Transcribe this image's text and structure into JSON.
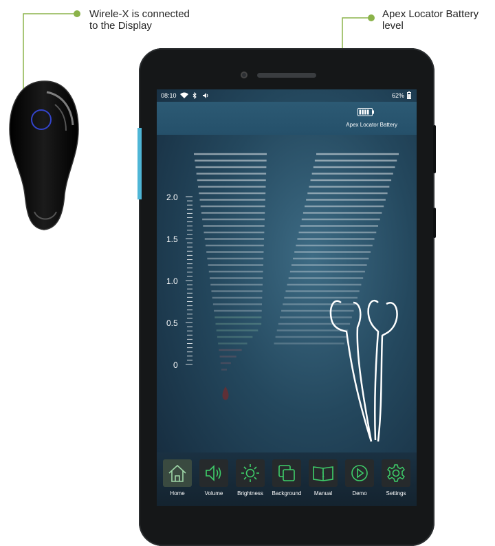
{
  "callouts": {
    "wireless": {
      "line1": "Wirele-X is connected",
      "line2": "to the Display"
    },
    "battery": {
      "line1": "Apex Locator Battery",
      "line2": "level"
    }
  },
  "status_bar": {
    "time": "08:10",
    "battery_percent": "62%",
    "icons": [
      "wifi-icon",
      "bluetooth-icon",
      "volume-icon",
      "battery-icon"
    ]
  },
  "battery_indicator": {
    "label": "Apex Locator Battery",
    "level_fraction": 0.8
  },
  "scale": {
    "labels": [
      "2.0",
      "1.5",
      "1.0",
      "0.5",
      "0"
    ]
  },
  "toolbar": {
    "items": [
      {
        "label": "Home",
        "icon": "home-icon"
      },
      {
        "label": "Volume",
        "icon": "volume-icon"
      },
      {
        "label": "Brightness",
        "icon": "sun-icon"
      },
      {
        "label": "Background",
        "icon": "background-icon"
      },
      {
        "label": "Manual",
        "icon": "book-icon"
      },
      {
        "label": "Demo",
        "icon": "play-icon"
      },
      {
        "label": "Settings",
        "icon": "gear-icon"
      }
    ]
  },
  "colors": {
    "callout_green": "#8bb34a",
    "accent_green": "#3ecf6a",
    "screen_blue": "#2c5a74"
  }
}
